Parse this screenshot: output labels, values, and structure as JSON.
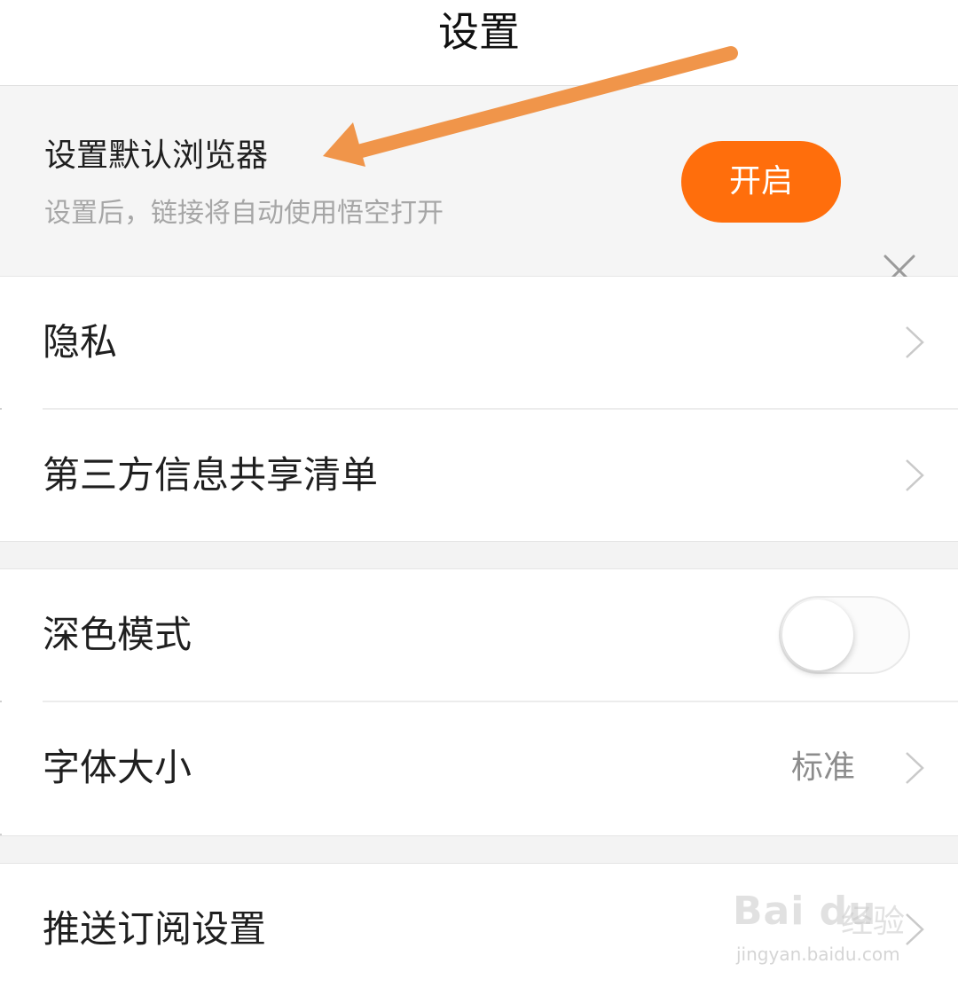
{
  "header": {
    "title": "设置"
  },
  "banner": {
    "title": "设置默认浏览器",
    "subtitle": "设置后，链接将自动使用悟空打开",
    "enable_label": "开启",
    "accent_color": "#ff6e0c",
    "arrow_color": "#f0954a"
  },
  "section1": {
    "items": [
      {
        "label": "隐私"
      },
      {
        "label": "第三方信息共享清单"
      }
    ]
  },
  "section2": {
    "dark_mode": {
      "label": "深色模式",
      "enabled": false
    },
    "font_size": {
      "label": "字体大小",
      "value": "标准"
    }
  },
  "section3": {
    "items": [
      {
        "label": "推送订阅设置"
      }
    ]
  },
  "watermark": {
    "logo": "Bai du",
    "text": "经验",
    "url": "jingyan.baidu.com"
  }
}
